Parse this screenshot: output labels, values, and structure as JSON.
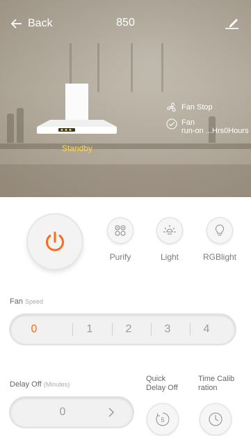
{
  "header": {
    "back_label": "Back",
    "title": "850"
  },
  "device": {
    "status": "Standby",
    "fan_stop": "Fan Stop",
    "fan_runon_line1": "Fan",
    "fan_runon_line2": "run-on ...Hrs0Hours"
  },
  "functions": [
    {
      "label": "Purify",
      "icon": "purify-icon"
    },
    {
      "label": "Light",
      "icon": "light-icon"
    },
    {
      "label": "RGBlight",
      "icon": "bulb-icon"
    }
  ],
  "fan": {
    "label": "Fan",
    "sublabel": "Speed",
    "speeds": [
      "0",
      "1",
      "2",
      "3",
      "4"
    ],
    "selected": "0"
  },
  "delay": {
    "label": "Delay Off",
    "unit": "(Minutes)",
    "value": "0",
    "quick_line1": "Quick",
    "quick_line2": "Delay Off",
    "quick_value": "5",
    "calib_line1": "Time Calib",
    "calib_line2": "ration"
  },
  "colors": {
    "accent": "#ff6a1a",
    "status": "#ffd84a",
    "button_bg": "#f3f3f3"
  }
}
